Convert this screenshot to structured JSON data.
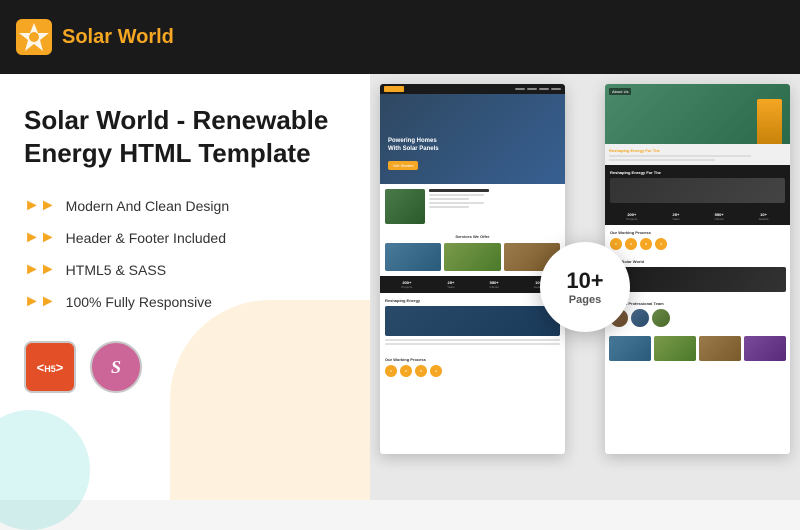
{
  "header": {
    "logo_text_first": "Solar",
    "logo_text_second": " World",
    "logo_icon_label": "solar-world-icon"
  },
  "left_panel": {
    "title": "Solar World - Renewable Energy HTML Template",
    "features": [
      "Modern And Clean Design",
      "Header & Footer Included",
      "HTML5 & SASS",
      "100% Fully Responsive"
    ],
    "badges": {
      "html": "HTML",
      "html_version": "5",
      "sass": "Sass"
    }
  },
  "pages_badge": {
    "count": "10+",
    "label": "Pages"
  },
  "preview_left": {
    "navbar_logo": "Solar",
    "hero_text_line1": "Powering Homes",
    "hero_text_line2": "With Solar Panels",
    "hero_btn": "Get Started",
    "about_title": "About Our Factory",
    "services_title": "Services We Offer",
    "stats": [
      {
        "num": "200+",
        "label": "Projects"
      },
      {
        "num": "25+",
        "label": "Years"
      },
      {
        "num": "550+",
        "label": "Clients"
      },
      {
        "num": "10+",
        "label": "Awards"
      }
    ]
  },
  "preview_right": {
    "about_badge": "About Us",
    "dark_title": "Reshaping Energy For The",
    "working_title": "Our Working Process",
    "about_title": "About Solar World",
    "team_title": "We Are A Professional Team"
  },
  "preview_bottom": {
    "hero_title": "Reshaping Energy For The Future",
    "working_title": "Our Working Process"
  }
}
